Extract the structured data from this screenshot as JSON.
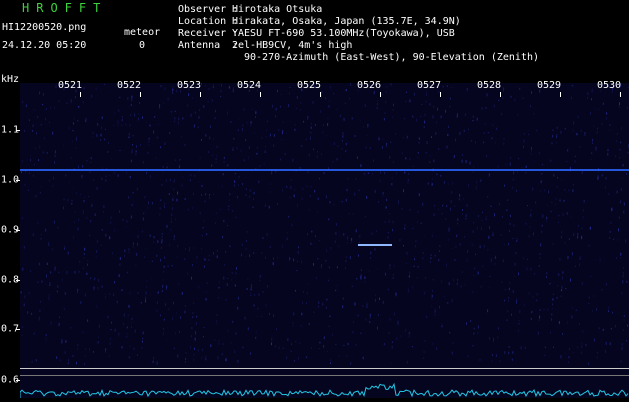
{
  "header": {
    "app_title": "HROFFT",
    "file_name": "HI12200520.png",
    "date_time": "24.12.20 05:20",
    "meteor_label": "meteor",
    "meteor_count": "0"
  },
  "info": [
    {
      "label": "Observer :",
      "value": "Hirotaka Otsuka"
    },
    {
      "label": "Location :",
      "value": "Hirakata, Osaka, Japan (135.7E, 34.9N)"
    },
    {
      "label": "Receiver :",
      "value": "YAESU FT-690 53.100MHz(Toyokawa), USB"
    },
    {
      "label": "Antenna  :",
      "value": "2el-HB9CV, 4m's high"
    },
    {
      "label": "",
      "value": "90-270-Azimuth (East-West), 90-Elevation (Zenith)"
    }
  ],
  "spectrogram": {
    "y_unit": "kHz",
    "time_labels": [
      "0521",
      "0522",
      "0523",
      "0524",
      "0525",
      "0526",
      "0527",
      "0528",
      "0529",
      "0530"
    ],
    "freq_labels": [
      "1.1",
      "1.0",
      "0.9",
      "0.8",
      "0.7",
      "0.6"
    ],
    "background_color": "#05051f",
    "signal_color": "#2b66ff"
  }
}
